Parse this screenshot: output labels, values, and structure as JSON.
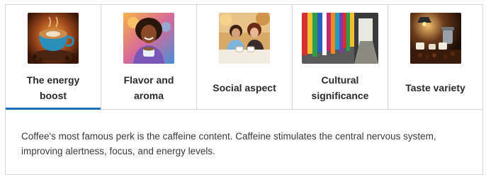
{
  "tabs": [
    {
      "label": "The energy boost",
      "image_icon": "latte-art-cup-image",
      "selected": true
    },
    {
      "label": "Flavor and aroma",
      "image_icon": "woman-with-coffee-image",
      "selected": false
    },
    {
      "label": "Social aspect",
      "image_icon": "friends-at-cafe-image",
      "selected": false
    },
    {
      "label": "Cultural significance",
      "image_icon": "colorful-flags-corridor-image",
      "selected": false
    },
    {
      "label": "Taste variety",
      "image_icon": "coffee-varieties-image",
      "selected": false
    }
  ],
  "panel": {
    "text": "Coffee's most famous perk is the caffeine content. Caffeine stimulates the central nervous system, improving alertness, focus, and energy levels."
  },
  "colors": {
    "accent": "#1a6fb5",
    "border": "#d6d6d6",
    "label": "#2b2b2b",
    "body_text": "#3a3a3a"
  }
}
